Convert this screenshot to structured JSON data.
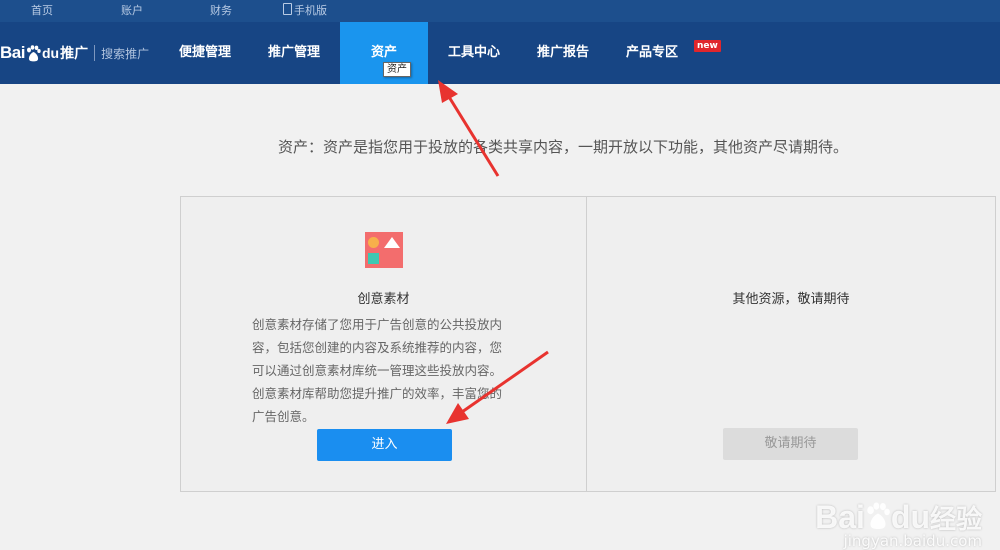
{
  "topbar": {
    "links": [
      "首页",
      "账户",
      "财务",
      "手机版"
    ]
  },
  "logo": {
    "bai": "Bai",
    "du": "du",
    "product": "推广",
    "subtitle": "搜索推广"
  },
  "nav": {
    "items": [
      {
        "label": "便捷管理"
      },
      {
        "label": "推广管理"
      },
      {
        "label": "资产",
        "active": true
      },
      {
        "label": "工具中心"
      },
      {
        "label": "推广报告"
      },
      {
        "label": "产品专区",
        "badge": "new"
      }
    ],
    "tooltip": "资产"
  },
  "main": {
    "description": "资产：资产是指您用于投放的各类共享内容，一期开放以下功能，其他资产尽请期待。",
    "card_creative": {
      "icon": "creative-material-icon",
      "title": "创意素材",
      "text": "创意素材存储了您用于广告创意的公共投放内容，包括您创建的内容及系统推荐的内容，您可以通过创意素材库统一管理这些投放内容。创意素材库帮助您提升推广的效率，丰富您的广告创意。",
      "button": "进入"
    },
    "card_other": {
      "title": "其他资源，敬请期待",
      "button": "敬请期待"
    }
  },
  "watermark": {
    "brand": "Bai",
    "brand2": "du",
    "brand3": "经验",
    "url": "jingyan.baidu.com"
  },
  "colors": {
    "topbar": "#1d4f8d",
    "navbar": "#174584",
    "active_tab": "#1a95ee",
    "primary_button": "#1a8ef0",
    "annotation_arrow": "#e8332f"
  }
}
